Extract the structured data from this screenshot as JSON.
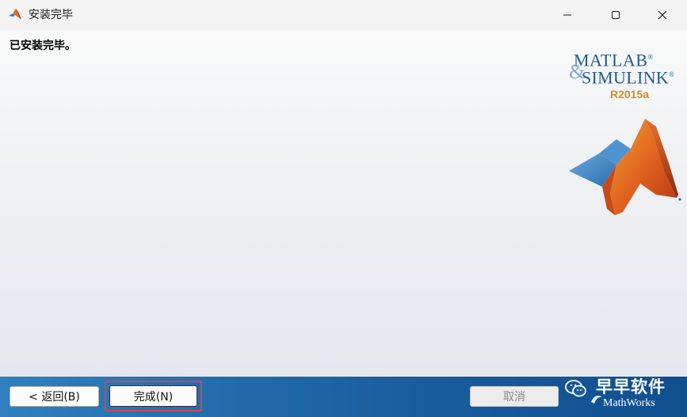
{
  "window": {
    "title": "安装完毕",
    "app_icon": "matlab-membrane-icon",
    "controls": {
      "minimize_icon": "minimize-icon",
      "maximize_icon": "maximize-icon",
      "close_icon": "close-icon"
    }
  },
  "content": {
    "heading": "已安装完毕。"
  },
  "logo": {
    "line1": "MATLAB",
    "ampersand": "&",
    "line2": "SIMULINK",
    "registered": "®",
    "release": "R2015a",
    "colors": {
      "wordmark": "#1f5a96",
      "release": "#e08a1e"
    }
  },
  "footer": {
    "back_label": "< 返回(B)",
    "finish_label": "完成(N)",
    "cancel_label": "取消",
    "cancel_disabled": true,
    "watermark_text": "早早软件",
    "mathworks_text": "MathWorks",
    "colors": {
      "bar_start": "#2f7fbf",
      "bar_end": "#0f4f8e",
      "highlight": "#d0464f"
    }
  }
}
